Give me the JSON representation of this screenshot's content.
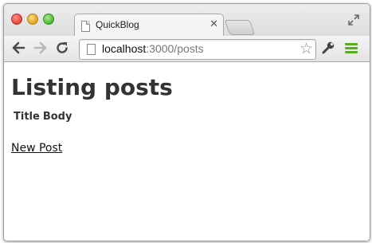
{
  "window": {
    "tab_title": "QuickBlog",
    "tab_close": "✕"
  },
  "toolbar": {
    "url_host": "localhost",
    "url_path": ":3000/posts"
  },
  "page": {
    "heading": "Listing posts",
    "columns": [
      "Title",
      "Body"
    ],
    "new_link": "New Post"
  }
}
